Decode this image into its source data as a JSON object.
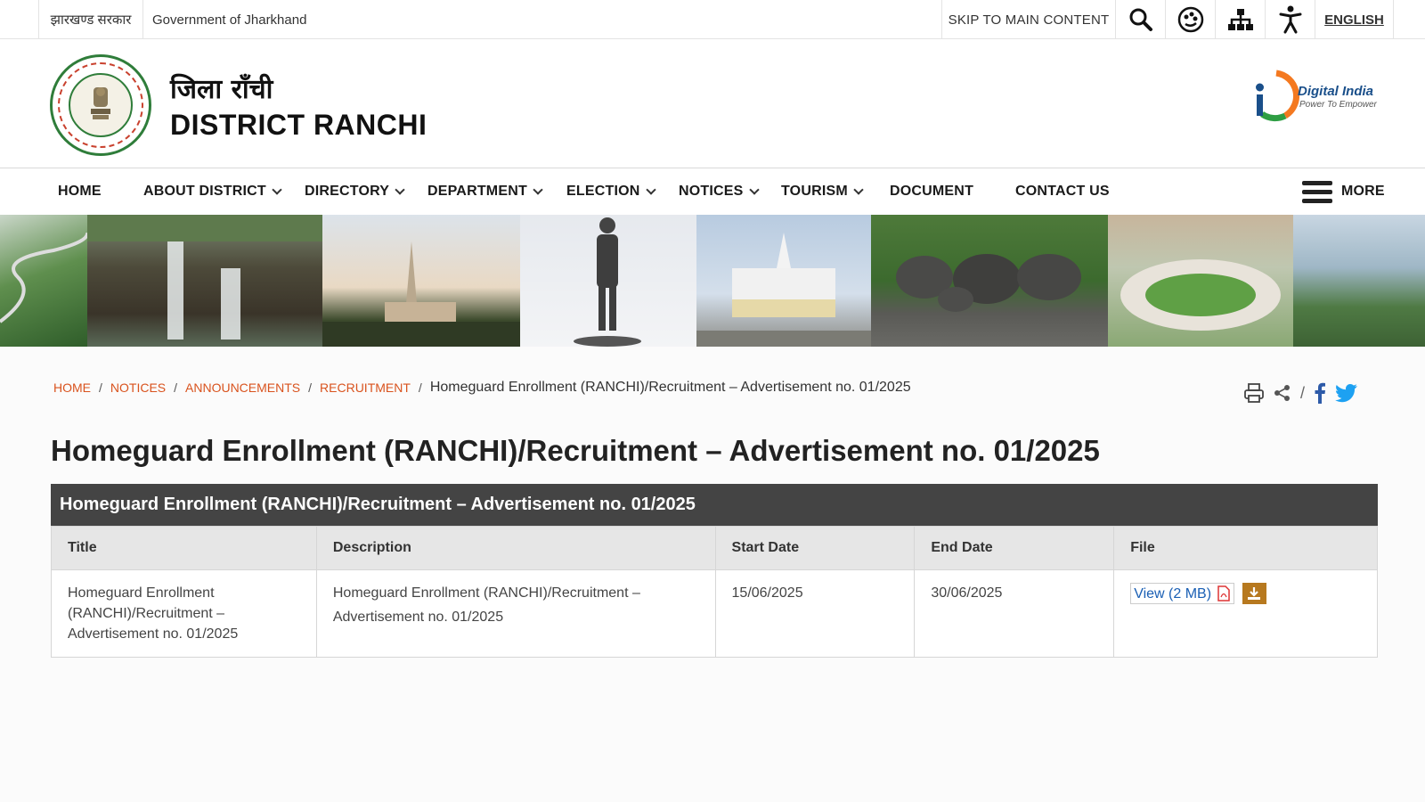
{
  "topbar": {
    "hindi_gov": "झारखण्ड सरकार",
    "gov_name": "Government of Jharkhand",
    "skip": "SKIP TO MAIN CONTENT",
    "language": "ENGLISH"
  },
  "header": {
    "site_hindi": "जिला राँची",
    "site_name": "DISTRICT RANCHI",
    "digital_india": "Digital India",
    "digital_india_tagline": "Power To Empower"
  },
  "nav": {
    "items": [
      {
        "label": "HOME",
        "dropdown": false
      },
      {
        "label": "ABOUT DISTRICT",
        "dropdown": true
      },
      {
        "label": "DIRECTORY",
        "dropdown": true
      },
      {
        "label": "DEPARTMENT",
        "dropdown": true
      },
      {
        "label": "ELECTION",
        "dropdown": true
      },
      {
        "label": "NOTICES",
        "dropdown": true
      },
      {
        "label": "TOURISM",
        "dropdown": true
      },
      {
        "label": "DOCUMENT",
        "dropdown": false
      },
      {
        "label": "CONTACT US",
        "dropdown": false
      }
    ],
    "more": "MORE"
  },
  "breadcrumb": {
    "links": [
      "HOME",
      "NOTICES",
      "ANNOUNCEMENTS",
      "RECRUITMENT"
    ],
    "current": "Homeguard Enrollment (RANCHI)/Recruitment – Advertisement no. 01/2025"
  },
  "page": {
    "title": "Homeguard Enrollment (RANCHI)/Recruitment – Advertisement no. 01/2025"
  },
  "table": {
    "caption": "Homeguard Enrollment (RANCHI)/Recruitment – Advertisement no. 01/2025",
    "headers": [
      "Title",
      "Description",
      "Start Date",
      "End Date",
      "File"
    ],
    "rows": [
      {
        "title": "Homeguard Enrollment (RANCHI)/Recruitment – Advertisement no. 01/2025",
        "description": "Homeguard Enrollment (RANCHI)/Recruitment – Advertisement no. 01/2025",
        "start_date": "15/06/2025",
        "end_date": "30/06/2025",
        "file_label": "View (2 MB)"
      }
    ]
  },
  "colors": {
    "breadcrumb_link": "#d9531e",
    "caption_bg": "#444444",
    "download_btn": "#b7791f",
    "link_blue": "#1a5fb4"
  }
}
